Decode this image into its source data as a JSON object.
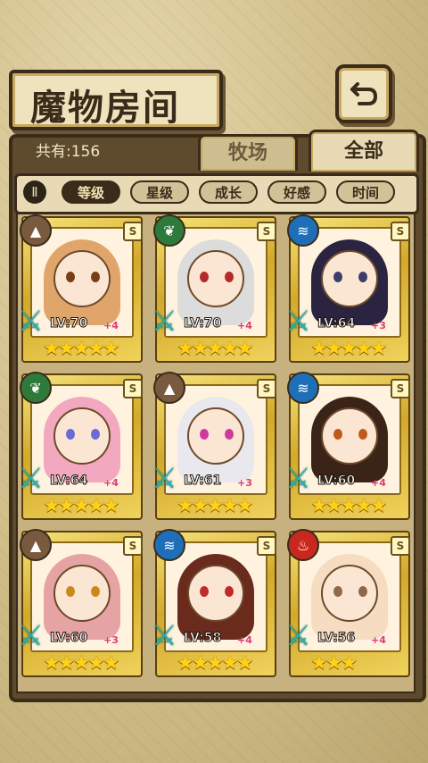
{
  "header": {
    "title": "魔物房间"
  },
  "info": {
    "count_label": "共有:156"
  },
  "tabs": [
    {
      "label": "牧场",
      "active": false
    },
    {
      "label": "全部",
      "active": true
    }
  ],
  "filters": {
    "toggle_label": "Ⅱ",
    "chips": [
      {
        "label": "等级",
        "active": true
      },
      {
        "label": "星级",
        "active": false
      },
      {
        "label": "成长",
        "active": false
      },
      {
        "label": "好感",
        "active": false
      },
      {
        "label": "时间",
        "active": false
      }
    ]
  },
  "badge_letter": "S",
  "monsters": [
    {
      "level": "LV:70",
      "bonus": "+4",
      "stars": "★★★★★",
      "element": "earth",
      "hair": "#e0a56b",
      "eye": "#7a3d14"
    },
    {
      "level": "LV:70",
      "bonus": "+4",
      "stars": "★★★★★",
      "element": "wood",
      "hair": "#dcdcdc",
      "eye": "#b22a2a"
    },
    {
      "level": "LV:64",
      "bonus": "+3",
      "stars": "★★★★★",
      "element": "water",
      "hair": "#2a2440",
      "eye": "#3d3d6a"
    },
    {
      "level": "LV:64",
      "bonus": "+4",
      "stars": "★★★★★",
      "element": "wood",
      "hair": "#f2a9bf",
      "eye": "#6a6ad8"
    },
    {
      "level": "LV:61",
      "bonus": "+3",
      "stars": "★★★★★",
      "element": "earth",
      "hair": "#e8e8ee",
      "eye": "#d03aa0"
    },
    {
      "level": "LV:60",
      "bonus": "+4",
      "stars": "★★★★★",
      "element": "water",
      "hair": "#3a2418",
      "eye": "#c05a1a"
    },
    {
      "level": "LV:60",
      "bonus": "+3",
      "stars": "★★★★★",
      "element": "earth",
      "hair": "#e6a3a3",
      "eye": "#c98a1a"
    },
    {
      "level": "LV:58",
      "bonus": "+4",
      "stars": "★★★★★",
      "element": "water",
      "hair": "#6a2a1c",
      "eye": "#c02a2a"
    },
    {
      "level": "LV:56",
      "bonus": "+4",
      "stars": "★★★",
      "element": "fire",
      "hair": "#f6dcc0",
      "eye": "#8a6a4a"
    }
  ],
  "element_colors": {
    "earth": "#7a5a3e",
    "wood": "#2e7a3a",
    "water": "#1e6fb8",
    "fire": "#c8281e"
  },
  "element_glyphs": {
    "earth": "▲",
    "wood": "❦",
    "water": "≋",
    "fire": "♨"
  }
}
